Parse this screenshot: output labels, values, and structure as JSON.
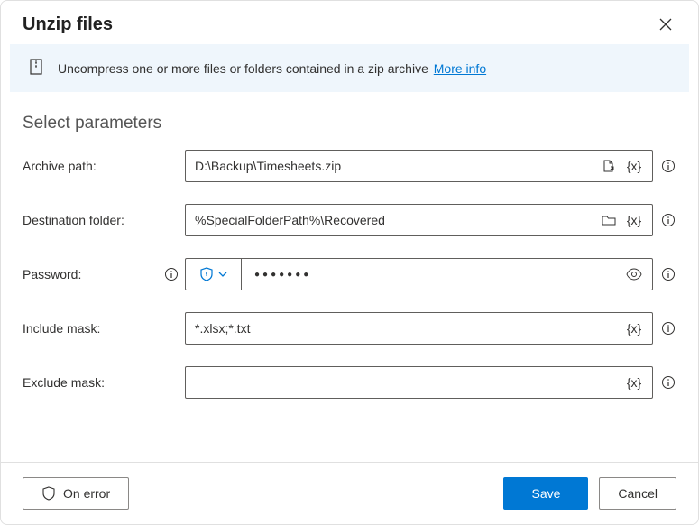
{
  "header": {
    "title": "Unzip files"
  },
  "banner": {
    "text": "Uncompress one or more files or folders contained in a zip archive ",
    "link": "More info"
  },
  "section_title": "Select parameters",
  "fields": {
    "archive": {
      "label": "Archive path:",
      "value": "D:\\Backup\\Timesheets.zip"
    },
    "dest": {
      "label": "Destination folder:",
      "value": "%SpecialFolderPath%\\Recovered"
    },
    "password": {
      "label": "Password:",
      "mask": "●●●●●●●"
    },
    "include": {
      "label": "Include mask:",
      "value": "*.xlsx;*.txt"
    },
    "exclude": {
      "label": "Exclude mask:",
      "value": ""
    }
  },
  "var_token": "{x}",
  "footer": {
    "on_error": "On error",
    "save": "Save",
    "cancel": "Cancel"
  }
}
